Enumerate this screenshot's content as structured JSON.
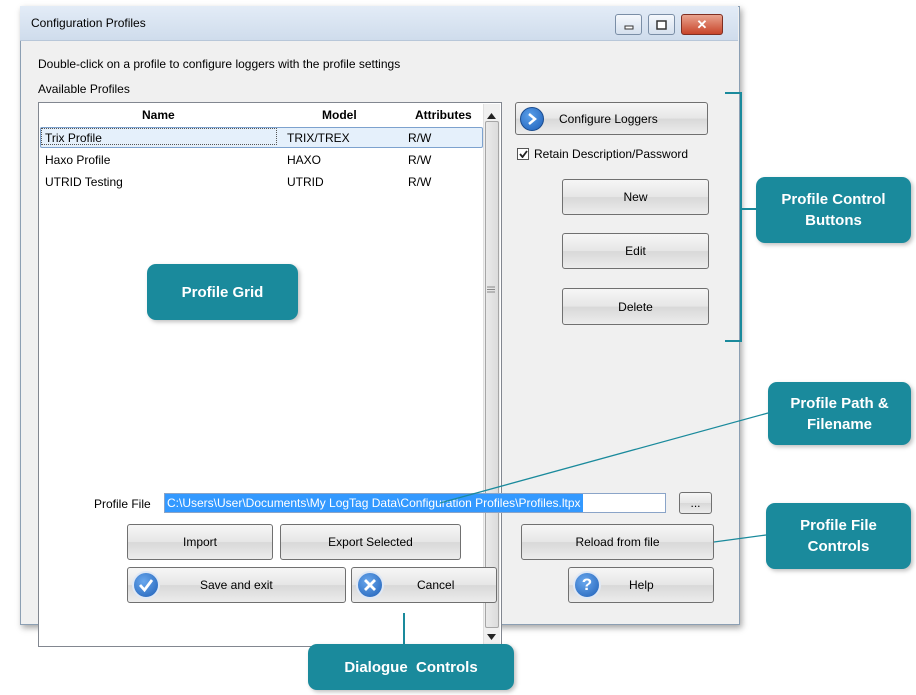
{
  "window": {
    "title": "Configuration Profiles",
    "instruction": "Double-click on a profile to configure loggers with the profile settings",
    "available_label": "Available Profiles"
  },
  "grid": {
    "columns": [
      "Name",
      "Model",
      "Attributes"
    ],
    "rows": [
      {
        "name": "Trix Profile",
        "model": "TRIX/TREX",
        "attributes": "R/W"
      },
      {
        "name": "Haxo Profile",
        "model": "HAXO",
        "attributes": "R/W"
      },
      {
        "name": "UTRID Testing",
        "model": "UTRID",
        "attributes": "R/W"
      }
    ]
  },
  "controls": {
    "configure_loggers": "Configure Loggers",
    "retain_label": "Retain Description/Password",
    "retain_checked": true,
    "new": "New",
    "edit": "Edit",
    "delete": "Delete"
  },
  "profile_file": {
    "label": "Profile File",
    "path": "C:\\Users\\User\\Documents\\My LogTag Data\\Configuration Profiles\\Profiles.ltpx",
    "browse": "..."
  },
  "bottom": {
    "import": "Import",
    "export_selected": "Export Selected",
    "reload": "Reload from file",
    "save_exit": "Save and exit",
    "cancel": "Cancel",
    "help": "Help"
  },
  "annotations": {
    "profile_grid": "Profile Grid",
    "profile_control_buttons": "Profile Control Buttons",
    "profile_path": "Profile Path & Filename",
    "profile_file_controls": "Profile File Controls",
    "dialogue_controls": "Dialogue  Controls"
  },
  "colors": {
    "callout": "#1a8a9c",
    "selection": "#3399ff"
  }
}
